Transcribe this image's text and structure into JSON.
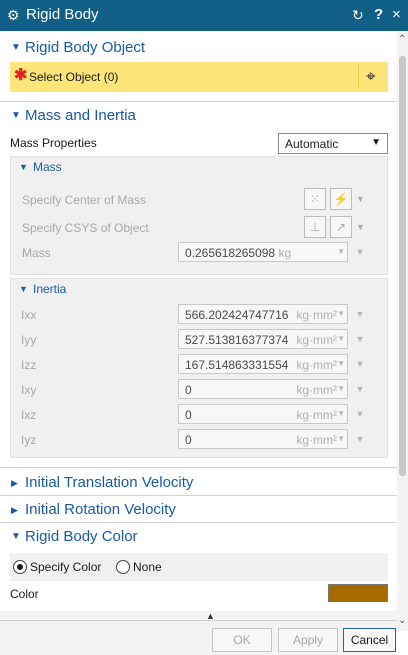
{
  "window": {
    "title": "Rigid Body",
    "gear_icon": "gear-icon",
    "reset_glyph": "↻",
    "help_glyph": "?",
    "close_glyph": "×"
  },
  "sections": {
    "rigid_body_object": {
      "label": "Rigid Body Object",
      "select_label": "Select Object (0)"
    },
    "mass_inertia": {
      "label": "Mass and Inertia",
      "mass_properties_label": "Mass Properties",
      "mass_properties_value": "Automatic",
      "mass_group": {
        "label": "Mass",
        "center_of_mass_label": "Specify Center of Mass",
        "csys_label": "Specify CSYS of Object",
        "mass_label": "Mass",
        "mass_value": "0.265618265098",
        "mass_unit": "kg"
      },
      "inertia_group": {
        "label": "Inertia",
        "rows": [
          {
            "label": "Ixx",
            "value": "566.202424747716",
            "unit": "kg·mm²"
          },
          {
            "label": "Iyy",
            "value": "527.513816377374",
            "unit": "kg·mm²"
          },
          {
            "label": "Izz",
            "value": "167.514863331554",
            "unit": "kg·mm²"
          },
          {
            "label": "Ixy",
            "value": "0",
            "unit": "kg·mm²"
          },
          {
            "label": "Ixz",
            "value": "0",
            "unit": "kg·mm²"
          },
          {
            "label": "Iyz",
            "value": "0",
            "unit": "kg·mm²"
          }
        ]
      }
    },
    "initial_translation": {
      "label": "Initial Translation Velocity"
    },
    "initial_rotation": {
      "label": "Initial Rotation Velocity"
    },
    "rigid_body_color": {
      "label": "Rigid Body Color",
      "option_specify": "Specify Color",
      "option_none": "None",
      "color_label": "Color",
      "swatch_color": "#a86a00"
    }
  },
  "footer": {
    "ok": "OK",
    "apply": "Apply",
    "cancel": "Cancel"
  },
  "colors": {
    "titlebar": "#0f5f86",
    "accent": "#1a5aa5",
    "select_highlight": "#fde57a"
  }
}
